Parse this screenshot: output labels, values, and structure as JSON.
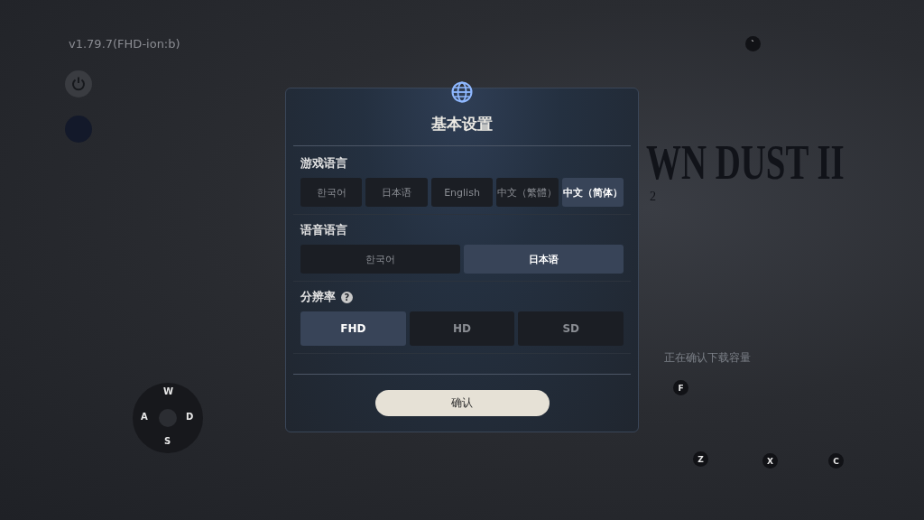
{
  "version": "v1.79.7(FHD-ion:b)",
  "logo": {
    "title": "WN DUST II",
    "subtitle": "2"
  },
  "status_text": "正在确认下载容量",
  "dialog": {
    "title": "基本设置",
    "sections": [
      {
        "label": "游戏语言",
        "kind": "small",
        "options": [
          {
            "label": "한국어",
            "selected": false
          },
          {
            "label": "日本语",
            "selected": false
          },
          {
            "label": "English",
            "selected": false
          },
          {
            "label": "中文（繁體）",
            "selected": false
          },
          {
            "label": "中文（简体）",
            "selected": true
          }
        ]
      },
      {
        "label": "语音语言",
        "kind": "small",
        "options": [
          {
            "label": "한국어",
            "selected": false
          },
          {
            "label": "日本语",
            "selected": true
          }
        ]
      },
      {
        "label": "分辨率",
        "help": "?",
        "kind": "large",
        "options": [
          {
            "label": "FHD",
            "selected": true
          },
          {
            "label": "HD",
            "selected": false
          },
          {
            "label": "SD",
            "selected": false
          }
        ]
      }
    ],
    "confirm": "确认"
  },
  "dpad": {
    "up": "W",
    "left": "A",
    "right": "D",
    "down": "S"
  },
  "key_hints": [
    {
      "key": "`"
    },
    {
      "key": "F"
    },
    {
      "key": "Z"
    },
    {
      "key": "X"
    },
    {
      "key": "C"
    }
  ]
}
